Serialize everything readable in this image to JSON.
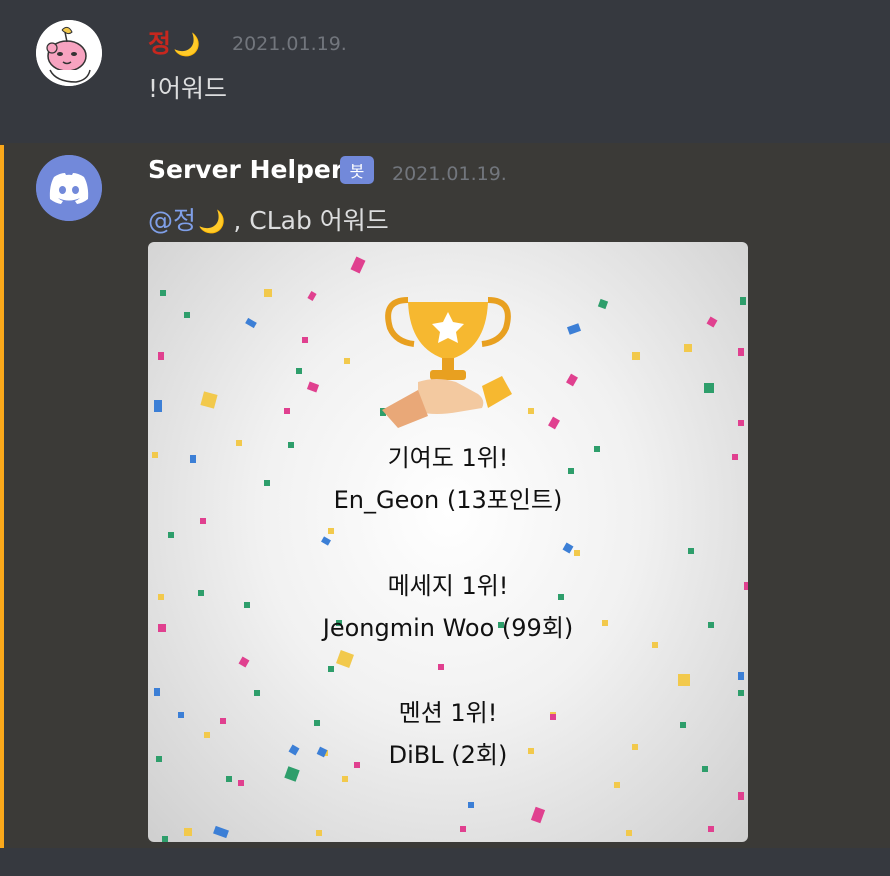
{
  "messages": [
    {
      "author": "정",
      "author_emoji": "🌙",
      "timestamp": "2021.01.19.",
      "content": "!어워드",
      "colors": {
        "author": "#c7271e"
      }
    },
    {
      "author": "Server Helper",
      "bot_tag": "봇",
      "timestamp": "2021.01.19.",
      "mention": "@정",
      "mention_emoji": "🌙",
      "content_rest": " , CLab 어워드",
      "colors": {
        "mention": "#7f9fe8",
        "highlight_bar": "#faa81a",
        "bot_tag": "#7289da"
      },
      "embed_image": {
        "icon": "trophy-hand-icon",
        "awards": [
          {
            "title": "기여도 1위!",
            "value": "En_Geon (13포인트)"
          },
          {
            "title": "메세지 1위!",
            "value": "Jeongmin Woo (99회)"
          },
          {
            "title": "멘션 1위!",
            "value": "DiBL (2회)"
          }
        ]
      }
    }
  ]
}
